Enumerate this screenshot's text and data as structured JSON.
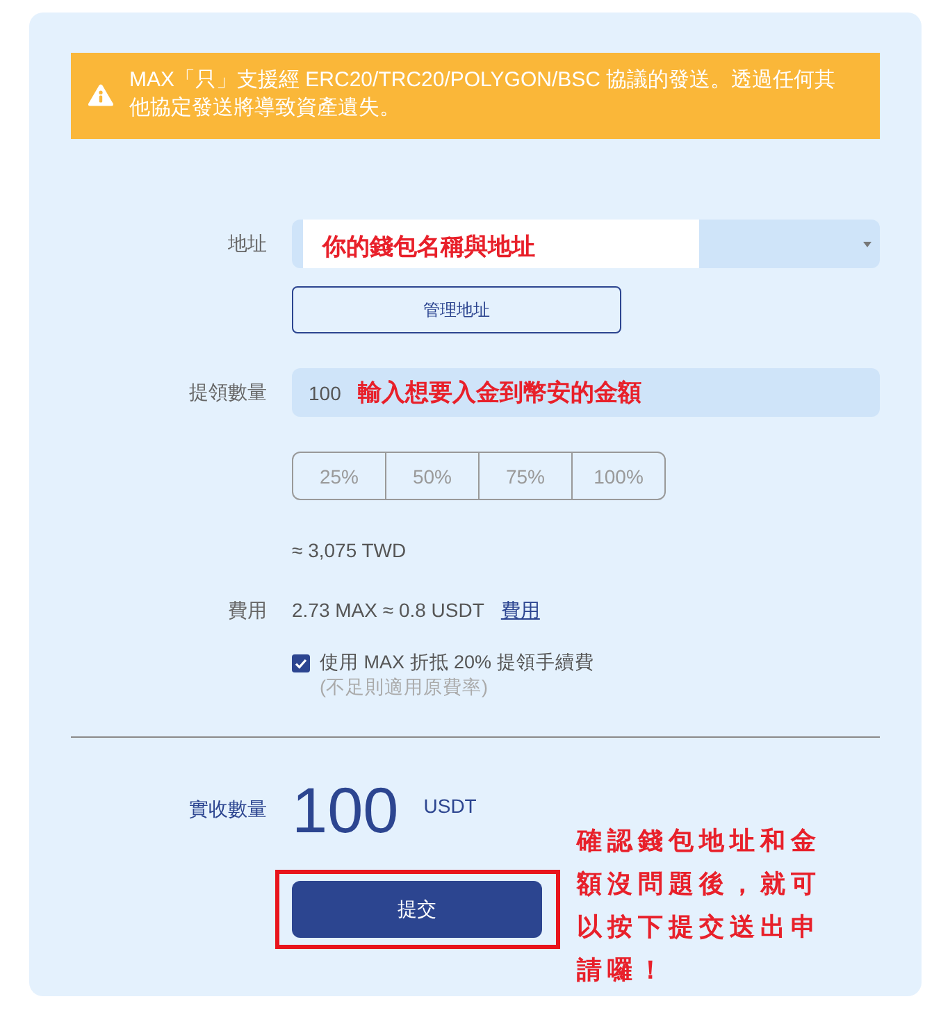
{
  "warning": {
    "text": "MAX「只」支援經 ERC20/TRC20/POLYGON/BSC 協議的發送。透過任何其他協定發送將導致資產遺失。"
  },
  "address": {
    "label": "地址",
    "annotation": "你的錢包名稱與地址",
    "manage_button": "管理地址"
  },
  "amount": {
    "label": "提領數量",
    "value": "100",
    "annotation": "輸入想要入金到幣安的金額",
    "presets": [
      "25%",
      "50%",
      "75%",
      "100%"
    ],
    "conversion": "≈ 3,075 TWD"
  },
  "fee": {
    "label": "費用",
    "value": "2.73 MAX ≈ 0.8 USDT",
    "link": "費用"
  },
  "discount": {
    "checked": true,
    "label": "使用 MAX 折抵 20% 提領手續費",
    "note": "(不足則適用原費率)"
  },
  "received": {
    "label": "實收數量",
    "value": "100",
    "unit": "USDT"
  },
  "submit": {
    "label": "提交",
    "highlighted": true
  },
  "callout": "確認錢包地址和金額沒問題後，就可以按下提交送出申請囉！"
}
